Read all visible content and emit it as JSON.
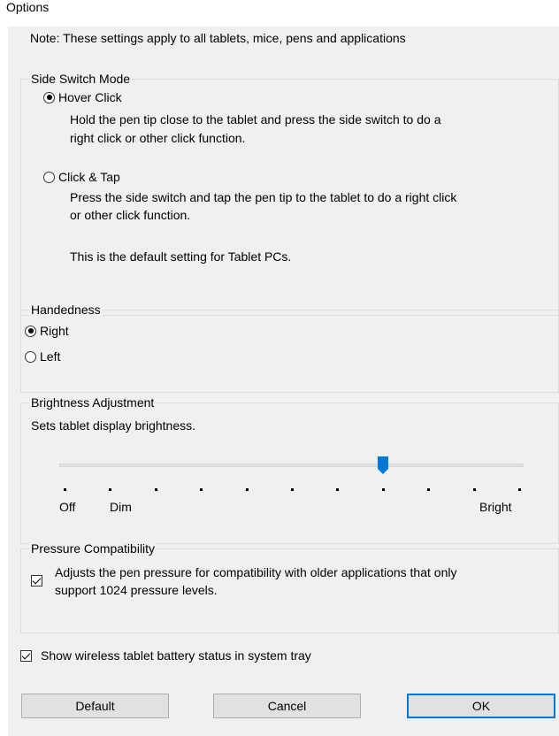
{
  "window": {
    "title": "Options"
  },
  "note": "Note: These settings apply to all tablets, mice, pens and applications",
  "side_switch": {
    "legend": "Side Switch Mode",
    "options": [
      {
        "label": "Hover Click",
        "checked": true,
        "desc1": "Hold the pen tip close to the tablet and press the side switch to do a",
        "desc2": "right click or other click function."
      },
      {
        "label": "Click & Tap",
        "checked": false,
        "desc1": "Press the side switch and tap the pen tip to the tablet to do a right click",
        "desc2": "or other click function.",
        "desc3": "This is the default setting for Tablet PCs."
      }
    ]
  },
  "handedness": {
    "legend": "Handedness",
    "options": [
      {
        "label": "Right",
        "checked": true
      },
      {
        "label": "Left",
        "checked": false
      }
    ]
  },
  "brightness": {
    "legend": "Brightness Adjustment",
    "desc": "Sets tablet display brightness.",
    "labels": {
      "off": "Off",
      "dim": "Dim",
      "bright": "Bright"
    },
    "tick_count": 11,
    "value_step": 7
  },
  "pressure": {
    "legend": "Pressure Compatibility",
    "checked": true,
    "desc1": "Adjusts the pen pressure for compatibility with older applications that only",
    "desc2": "support 1024 pressure levels."
  },
  "battery": {
    "checked": true,
    "label": "Show wireless tablet battery status in system tray"
  },
  "buttons": {
    "default": "Default",
    "cancel": "Cancel",
    "ok": "OK"
  }
}
